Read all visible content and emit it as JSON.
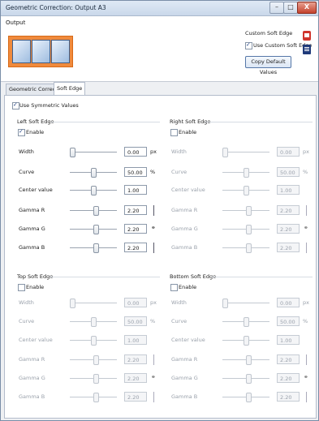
{
  "window": {
    "title": "Geometric Correction: Output A3",
    "min_label": "–",
    "max_label": "□",
    "close_label": "X"
  },
  "top": {
    "output_label": "Output",
    "custom_soft_edge_label": "Custom Soft Edge",
    "use_custom_soft_edge_label": "Use Custom Soft Edge",
    "use_custom_soft_edge_checked": true,
    "copy_default_label": "Copy Default Values"
  },
  "tabs": [
    {
      "label": "Geometric Correction",
      "active": false
    },
    {
      "label": "Soft Edge",
      "active": true
    }
  ],
  "use_symmetric_label": "Use Symmetric Values",
  "use_symmetric_checked": true,
  "sections": {
    "left": {
      "title": "Left Soft Edge",
      "enable_label": "Enable",
      "enabled": true,
      "rows": [
        {
          "label": "Width",
          "value": "0.00",
          "unit": "px",
          "level": 0.0
        },
        {
          "label": "Curve",
          "value": "50.00",
          "unit": "%",
          "level": 0.5
        },
        {
          "label": "Center value",
          "value": "1.00",
          "unit": "",
          "level": 0.5
        },
        {
          "label": "Gamma R",
          "value": "2.20",
          "unit": "",
          "level": 0.55
        },
        {
          "label": "Gamma G",
          "value": "2.20",
          "unit": "",
          "level": 0.55
        },
        {
          "label": "Gamma B",
          "value": "2.20",
          "unit": "",
          "level": 0.55
        }
      ]
    },
    "right": {
      "title": "Right Soft Edge",
      "enable_label": "Enable",
      "enabled": false,
      "rows": [
        {
          "label": "Width",
          "value": "0.00",
          "unit": "px",
          "level": 0.0
        },
        {
          "label": "Curve",
          "value": "50.00",
          "unit": "%",
          "level": 0.5
        },
        {
          "label": "Center value",
          "value": "1.00",
          "unit": "",
          "level": 0.5
        },
        {
          "label": "Gamma R",
          "value": "2.20",
          "unit": "",
          "level": 0.55
        },
        {
          "label": "Gamma G",
          "value": "2.20",
          "unit": "",
          "level": 0.55
        },
        {
          "label": "Gamma B",
          "value": "2.20",
          "unit": "",
          "level": 0.55
        }
      ]
    },
    "top": {
      "title": "Top Soft Edge",
      "enable_label": "Enable",
      "enabled": false,
      "rows": [
        {
          "label": "Width",
          "value": "0.00",
          "unit": "px",
          "level": 0.0
        },
        {
          "label": "Curve",
          "value": "50.00",
          "unit": "%",
          "level": 0.5
        },
        {
          "label": "Center value",
          "value": "1.00",
          "unit": "",
          "level": 0.5
        },
        {
          "label": "Gamma R",
          "value": "2.20",
          "unit": "",
          "level": 0.55
        },
        {
          "label": "Gamma G",
          "value": "2.20",
          "unit": "",
          "level": 0.55
        },
        {
          "label": "Gamma B",
          "value": "2.20",
          "unit": "",
          "level": 0.55
        }
      ]
    },
    "bottom": {
      "title": "Bottom Soft Edge",
      "enable_label": "Enable",
      "enabled": false,
      "rows": [
        {
          "label": "Width",
          "value": "0.00",
          "unit": "px",
          "level": 0.0
        },
        {
          "label": "Curve",
          "value": "50.00",
          "unit": "%",
          "level": 0.5
        },
        {
          "label": "Center value",
          "value": "1.00",
          "unit": "",
          "level": 0.5
        },
        {
          "label": "Gamma R",
          "value": "2.20",
          "unit": "",
          "level": 0.55
        },
        {
          "label": "Gamma G",
          "value": "2.20",
          "unit": "",
          "level": 0.55
        },
        {
          "label": "Gamma B",
          "value": "2.20",
          "unit": "",
          "level": 0.55
        }
      ]
    }
  },
  "colors": {
    "accent_orange": "#f08a3c",
    "icon_red": "#d0342c",
    "icon_blue": "#1f3a7a"
  }
}
